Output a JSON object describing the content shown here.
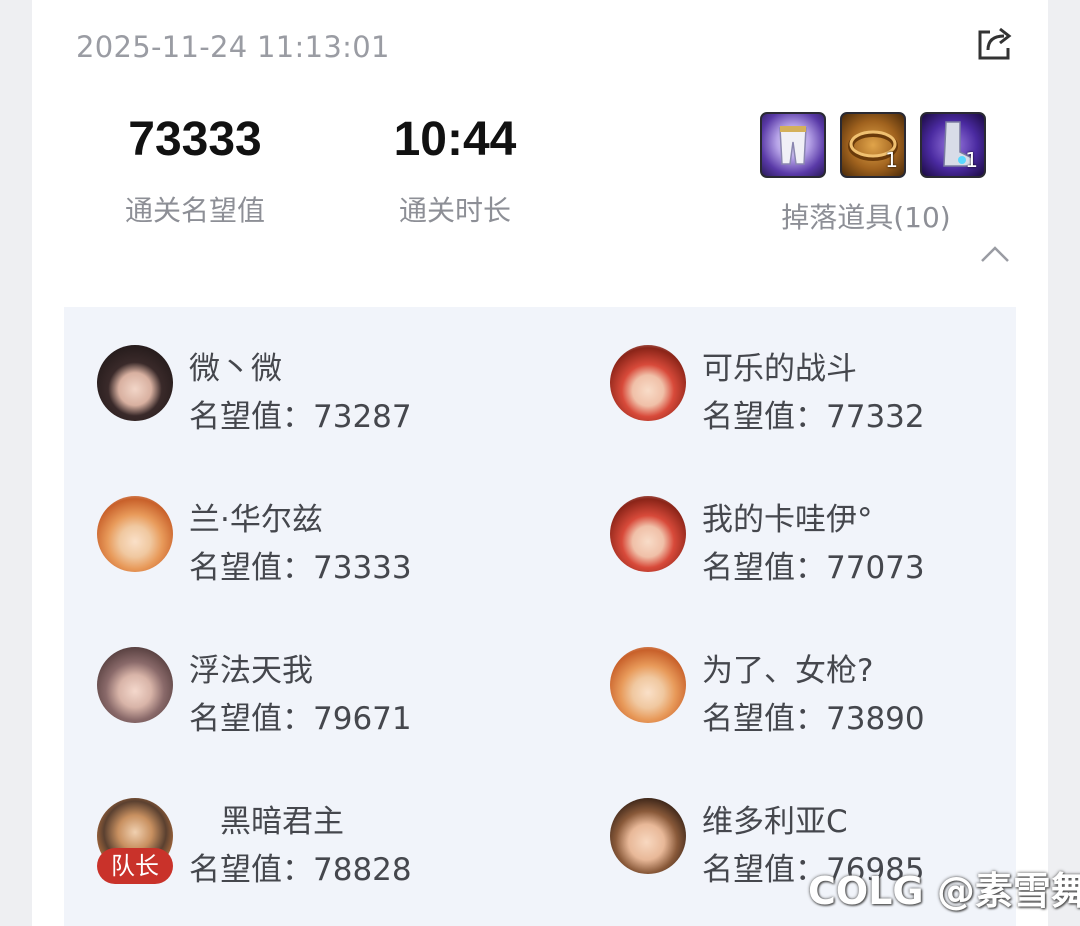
{
  "header": {
    "timestamp": "2025-11-24 11:13:01",
    "share_icon": "share-icon"
  },
  "stats": [
    {
      "value": "73333",
      "label": "通关名望值"
    },
    {
      "value": "10:44",
      "label": "通关时长"
    }
  ],
  "drops": {
    "label": "掉落道具(10)",
    "items": [
      {
        "icon": "armor-pants-icon",
        "count": ""
      },
      {
        "icon": "ring-bracelet-icon",
        "count": "1"
      },
      {
        "icon": "boots-icon",
        "count": "1"
      }
    ]
  },
  "collapse_icon": "chevron-up-icon",
  "team": {
    "fame_prefix": "名望值：",
    "leader_badge": "队长",
    "members": [
      {
        "name": "微丶微",
        "fame": "名望值：73287"
      },
      {
        "name": "可乐的战斗",
        "fame": "名望值：77332"
      },
      {
        "name": "兰·华尔兹",
        "fame": "名望值：73333"
      },
      {
        "name": "我的卡哇伊°",
        "fame": "名望值：77073"
      },
      {
        "name": "浮法天我",
        "fame": "名望值：79671"
      },
      {
        "name": "为了、女枪?",
        "fame": "名望值：73890"
      },
      {
        "name": "　黑暗君主",
        "fame": "名望值：78828"
      },
      {
        "name": "维多利亚C",
        "fame": "名望值：76985"
      }
    ]
  },
  "watermark": "COLG @素雪舞"
}
